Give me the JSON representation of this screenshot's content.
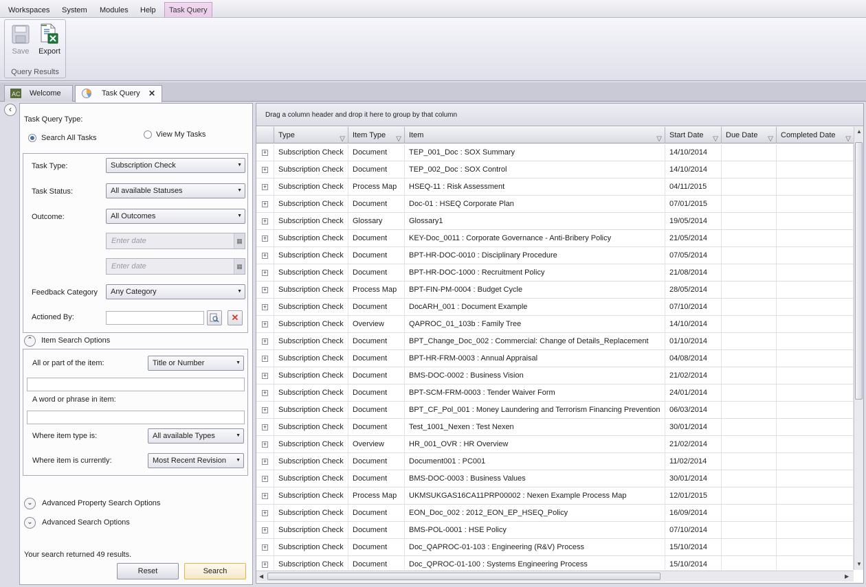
{
  "menu": [
    "Workspaces",
    "System",
    "Modules",
    "Help",
    "Task Query"
  ],
  "ribbon": {
    "save_label": "Save",
    "export_label": "Export",
    "group_label": "Query Results"
  },
  "doc_tabs": {
    "welcome": "Welcome",
    "task_query": "Task Query",
    "close_glyph": "✕"
  },
  "left": {
    "task_query_type_label": "Task Query Type:",
    "search_all_label": "Search All Tasks",
    "view_my_label": "View My Tasks",
    "task_type_label": "Task Type:",
    "task_type_value": "Subscription Check",
    "task_status_label": "Task Status:",
    "task_status_value": "All available Statuses",
    "outcome_label": "Outcome:",
    "outcome_value": "All Outcomes",
    "date_placeholder": "Enter date",
    "feedback_label": "Feedback Category",
    "feedback_value": "Any Category",
    "actioned_label": "Actioned By:",
    "item_search_label": "Item Search Options",
    "all_part_label": "All or part of the item:",
    "all_part_value": "Title or Number",
    "word_phrase_label": "A word or phrase in item:",
    "item_type_label": "Where item type is:",
    "item_type_value": "All available Types",
    "item_current_label": "Where item is currently:",
    "item_current_value": "Most Recent Revision",
    "adv_property_label": "Advanced Property Search Options",
    "adv_search_label": "Advanced Search Options",
    "result_text": "Your search returned 49 results.",
    "reset_label": "Reset",
    "search_label": "Search"
  },
  "grid": {
    "group_hint": "Drag a column header and drop it here to group by that column",
    "columns": [
      "Type",
      "Item Type",
      "Item",
      "Start Date",
      "Due Date",
      "Completed Date"
    ],
    "rows": [
      [
        "Subscription Check",
        "Document",
        "TEP_001_Doc : SOX Summary",
        "14/10/2014",
        "",
        ""
      ],
      [
        "Subscription Check",
        "Document",
        "TEP_002_Doc : SOX Control",
        "14/10/2014",
        "",
        ""
      ],
      [
        "Subscription Check",
        "Process Map",
        "HSEQ-11 : Risk Assessment",
        "04/11/2015",
        "",
        ""
      ],
      [
        "Subscription Check",
        "Document",
        "Doc-01 : HSEQ Corporate Plan",
        "07/01/2015",
        "",
        ""
      ],
      [
        "Subscription Check",
        "Glossary",
        "Glossary1",
        "19/05/2014",
        "",
        ""
      ],
      [
        "Subscription Check",
        "Document",
        "KEY-Doc_0011 : Corporate Governance - Anti-Bribery Policy",
        "21/05/2014",
        "",
        ""
      ],
      [
        "Subscription Check",
        "Document",
        "BPT-HR-DOC-0010 : Disciplinary Procedure",
        "07/05/2014",
        "",
        ""
      ],
      [
        "Subscription Check",
        "Document",
        "BPT-HR-DOC-1000 : Recruitment Policy",
        "21/08/2014",
        "",
        ""
      ],
      [
        "Subscription Check",
        "Process Map",
        "BPT-FIN-PM-0004 : Budget Cycle",
        "28/05/2014",
        "",
        ""
      ],
      [
        "Subscription Check",
        "Document",
        "DocARH_001 : Document Example",
        "07/10/2014",
        "",
        ""
      ],
      [
        "Subscription Check",
        "Overview",
        "QAPROC_01_103b : Family Tree",
        "14/10/2014",
        "",
        ""
      ],
      [
        "Subscription Check",
        "Document",
        "BPT_Change_Doc_002 : Commercial: Change of Details_Replacement",
        "01/10/2014",
        "",
        ""
      ],
      [
        "Subscription Check",
        "Document",
        "BPT-HR-FRM-0003 : Annual Appraisal",
        "04/08/2014",
        "",
        ""
      ],
      [
        "Subscription Check",
        "Document",
        "BMS-DOC-0002 : Business Vision",
        "21/02/2014",
        "",
        ""
      ],
      [
        "Subscription Check",
        "Document",
        "BPT-SCM-FRM-0003 : Tender Waiver Form",
        "24/01/2014",
        "",
        ""
      ],
      [
        "Subscription Check",
        "Document",
        "BPT_CF_Pol_001 : Money Laundering and Terrorism Financing Prevention",
        "06/03/2014",
        "",
        ""
      ],
      [
        "Subscription Check",
        "Document",
        "Test_1001_Nexen : Test Nexen",
        "30/01/2014",
        "",
        ""
      ],
      [
        "Subscription Check",
        "Overview",
        "HR_001_OVR : HR Overview",
        "21/02/2014",
        "",
        ""
      ],
      [
        "Subscription Check",
        "Document",
        "Document001 : PC001",
        "11/02/2014",
        "",
        ""
      ],
      [
        "Subscription Check",
        "Document",
        "BMS-DOC-0003 : Business Values",
        "30/01/2014",
        "",
        ""
      ],
      [
        "Subscription Check",
        "Process Map",
        "UKMSUKGAS16CA11PRP00002 : Nexen Example Process Map",
        "12/01/2015",
        "",
        ""
      ],
      [
        "Subscription Check",
        "Document",
        "EON_Doc_002 : 2012_EON_EP_HSEQ_Policy",
        "16/09/2014",
        "",
        ""
      ],
      [
        "Subscription Check",
        "Document",
        "BMS-POL-0001 : HSE Policy",
        "07/10/2014",
        "",
        ""
      ],
      [
        "Subscription Check",
        "Document",
        "Doc_QAPROC-01-103 : Engineering (R&V) Process",
        "15/10/2014",
        "",
        ""
      ],
      [
        "Subscription Check",
        "Document",
        "Doc_QPROC-01-100 : Systems Engineering Process",
        "15/10/2014",
        "",
        ""
      ]
    ]
  }
}
